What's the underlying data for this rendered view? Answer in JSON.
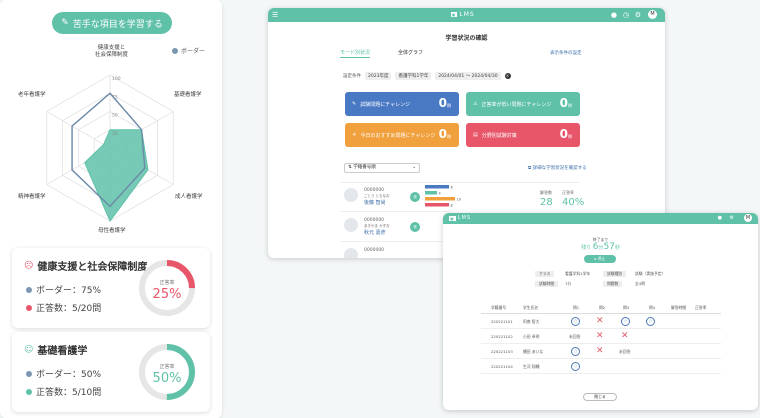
{
  "left_panel": {
    "learn_button": "苦手な項目を学習する",
    "legend_border": "ボーダー",
    "radar": {
      "axes": [
        "健康支援と\n社会保障制度",
        "基礎看護学",
        "成人看護学",
        "母性看護学",
        "精神看護学",
        "老年看護学"
      ],
      "ticks": [
        "100",
        "75",
        "50",
        "25"
      ],
      "border_series": [
        75,
        50,
        55,
        80,
        60,
        60
      ],
      "score_series": [
        25,
        50,
        60,
        100,
        40,
        10
      ]
    },
    "cards": [
      {
        "title": "健康支援と社会保障制度",
        "border_label": "ボーダー：75%",
        "correct_label": "正答数：5/20問",
        "caption": "正答率",
        "value": "25%",
        "percent": 25,
        "color": "#e8566a",
        "face": "☹"
      },
      {
        "title": "基礎看護学",
        "border_label": "ボーダー：50%",
        "correct_label": "正答数：5/10問",
        "caption": "正答率",
        "value": "50%",
        "percent": 50,
        "color": "#5fc1a8",
        "face": "☺"
      }
    ],
    "colors": {
      "accent": "#5fc1a8",
      "border": "#7a96b0",
      "bad": "#e8566a"
    }
  },
  "window1": {
    "logo": "LMS",
    "avatar": "M",
    "heading": "学習状況の確認",
    "tabs": [
      "モード別状況",
      "全体グラフ"
    ],
    "link_right": "表示条件の設定",
    "filter_label": "設定条件",
    "filter_tags": [
      "2023年度",
      "看護学科1学年",
      "2024/04/01 〜 2024/04/30"
    ],
    "tiles": [
      {
        "label": "試験問題にチャレンジ",
        "num": "0",
        "unit": "問",
        "color": "#4a79c4"
      },
      {
        "label": "正答率が低い問題にチャレンジ",
        "num": "0",
        "unit": "問",
        "color": "#5fc1a8"
      },
      {
        "label": "今日のおすすめ問題にチャレンジ",
        "num": "0",
        "unit": "問",
        "color": "#f0a03c"
      },
      {
        "label": "分野別試験対策",
        "num": "0",
        "unit": "問",
        "color": "#e8566a"
      }
    ],
    "sort_label": "学籍番号順",
    "detail_link": "詳細な学習状況を確認する",
    "students": [
      {
        "id": "0000000",
        "kana": "ごとう ともなお",
        "name": "後藤 智尚",
        "badge": "済"
      },
      {
        "id": "0000000",
        "kana": "あきやま かずお",
        "name": "秋元 嘉彦",
        "badge": "済"
      },
      {
        "id": "0000000",
        "kana": "",
        "name": "",
        "badge": ""
      }
    ],
    "bar_values": [
      8,
      4,
      10,
      8
    ],
    "stats": [
      {
        "label": "解答数",
        "value": "28"
      },
      {
        "label": "正答率",
        "value": "40%"
      }
    ]
  },
  "window2": {
    "logo": "LMS",
    "avatar": "M",
    "timer_caption": "終了まで",
    "timer_prefix": "残り",
    "timer_min": "6",
    "timer_min_unit": "分",
    "timer_sec": "57",
    "timer_sec_unit": "秒",
    "green_button": "停止",
    "info": [
      {
        "k": "クラス",
        "v": "看護学科1学年"
      },
      {
        "k": "試験種別",
        "v": "試験（実施予定）"
      },
      {
        "k": "試験時間",
        "v": "7分"
      },
      {
        "k": "問題数",
        "v": "全4問"
      }
    ],
    "headers": [
      "学籍番号",
      "学生氏名",
      "問1",
      "問2",
      "問3",
      "問4",
      "解答時間",
      "正答率"
    ],
    "rows": [
      {
        "id": "220221101",
        "name": "阿南 智大",
        "marks": [
          "o",
          "x",
          "o",
          "o"
        ]
      },
      {
        "id": "220221102",
        "name": "小田 卓明",
        "marks": [
          "未回答",
          "x",
          "x",
          ""
        ]
      },
      {
        "id": "220221103",
        "name": "幡田 あいな",
        "marks": [
          "o",
          "x",
          "未回答",
          ""
        ]
      },
      {
        "id": "220221104",
        "name": "生河 翔輔",
        "marks": [
          "o",
          "",
          "",
          ""
        ]
      }
    ],
    "close_button": "閉じる"
  }
}
